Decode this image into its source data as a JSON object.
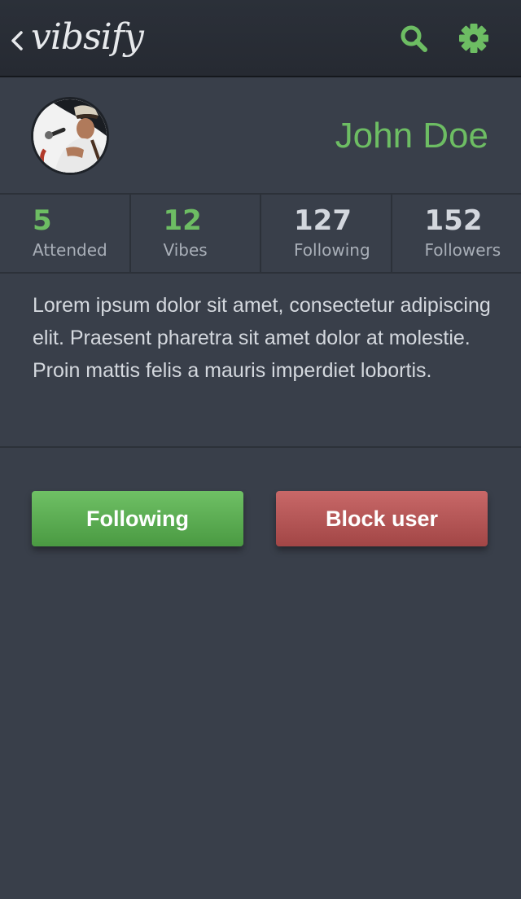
{
  "app": {
    "brand": "vibsify",
    "accent": "#6dbd63",
    "danger": "#b85858"
  },
  "header": {
    "back_icon": "chevron-left-icon",
    "search_icon": "search-icon",
    "settings_icon": "gear-icon"
  },
  "profile": {
    "name": "John Doe",
    "avatar_icon": "avatar-photo"
  },
  "stats": [
    {
      "value": "5",
      "label": "Attended",
      "highlight": true
    },
    {
      "value": "12",
      "label": "Vibes",
      "highlight": true
    },
    {
      "value": "127",
      "label": "Following",
      "highlight": false
    },
    {
      "value": "152",
      "label": "Followers",
      "highlight": false
    }
  ],
  "bio": "Lorem ipsum dolor sit amet, consectetur adipiscing elit. Praesent pharetra sit amet dolor at molestie. Proin mattis felis a mauris imperdiet lobortis.",
  "actions": {
    "follow_label": "Following",
    "block_label": "Block user"
  }
}
